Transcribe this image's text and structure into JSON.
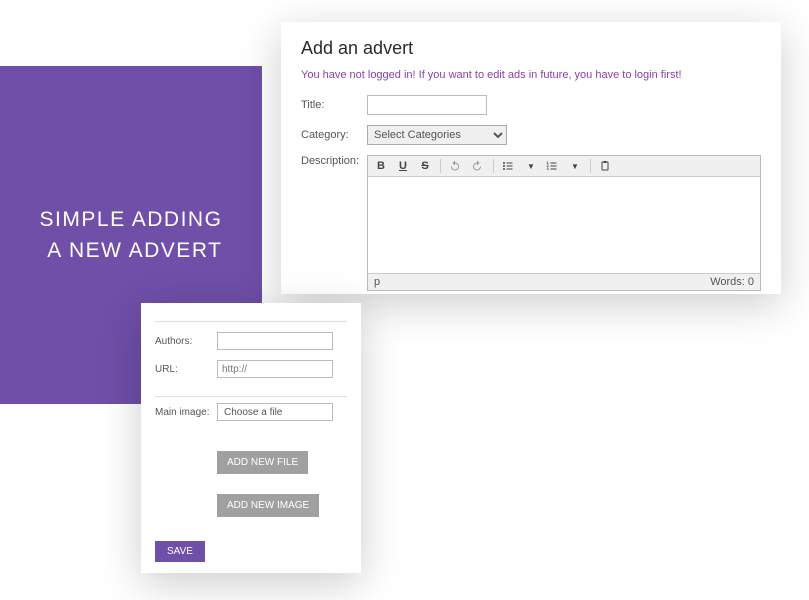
{
  "promo": {
    "line1": "SIMPLE ADDING",
    "line2": "A NEW ADVERT"
  },
  "form": {
    "title": "Add an advert",
    "warning": "You have not logged in! If you want to edit ads in future, you have to login first!",
    "labels": {
      "title": "Title:",
      "category": "Category:",
      "description": "Description:",
      "authors": "Authors:",
      "url": "URL:",
      "mainimage": "Main image:"
    },
    "category_placeholder": "Select Categories",
    "url_placeholder": "http://",
    "file_placeholder": "Choose a file",
    "editor": {
      "path": "p",
      "words_label": "Words: 0"
    }
  },
  "buttons": {
    "add_file": "ADD NEW FILE",
    "add_image": "ADD NEW IMAGE",
    "save": "SAVE"
  }
}
